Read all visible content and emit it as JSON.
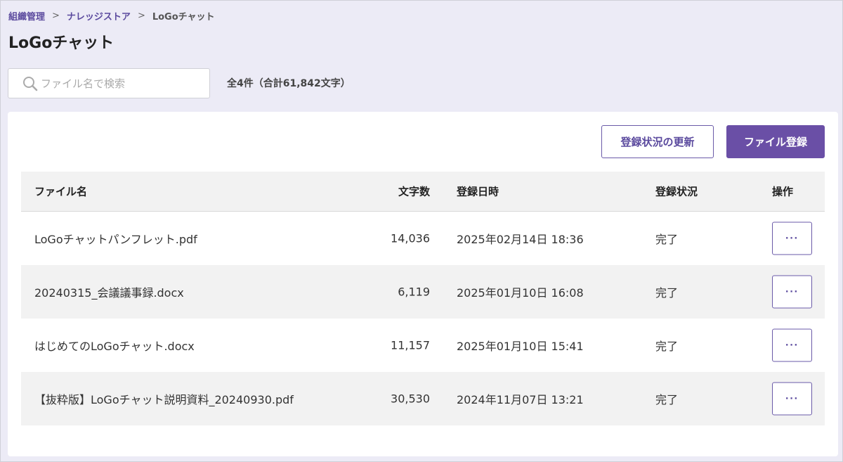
{
  "breadcrumb": {
    "items": [
      "組織管理",
      "ナレッジストア"
    ],
    "current": "LoGoチャット",
    "separator": ">"
  },
  "page": {
    "title": "LoGoチャット"
  },
  "search": {
    "placeholder": "ファイル名で検索",
    "value": ""
  },
  "summary": {
    "total_text": "全4件（合計61,842文字）"
  },
  "toolbar": {
    "refresh_label": "登録状況の更新",
    "upload_label": "ファイル登録"
  },
  "table": {
    "headers": {
      "name": "ファイル名",
      "chars": "文字数",
      "date": "登録日時",
      "status": "登録状況",
      "ops": "操作"
    },
    "rows": [
      {
        "name": "LoGoチャットパンフレット.pdf",
        "chars": "14,036",
        "date": "2025年02月14日 18:36",
        "status": "完了",
        "ops_label": "···"
      },
      {
        "name": "20240315_会議議事録.docx",
        "chars": "6,119",
        "date": "2025年01月10日 16:08",
        "status": "完了",
        "ops_label": "···"
      },
      {
        "name": "はじめてのLoGoチャット.docx",
        "chars": "11,157",
        "date": "2025年01月10日 15:41",
        "status": "完了",
        "ops_label": "···"
      },
      {
        "name": "【抜粋版】LoGoチャット説明資料_20240930.pdf",
        "chars": "30,530",
        "date": "2024年11月07日 13:21",
        "status": "完了",
        "ops_label": "···"
      }
    ]
  },
  "colors": {
    "accent": "#6a4fa6",
    "page_bg": "#ecebf6",
    "row_alt": "#f2f2f2"
  },
  "icons": {
    "search": "search-icon"
  }
}
